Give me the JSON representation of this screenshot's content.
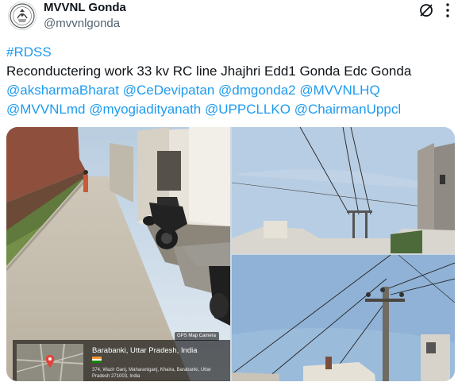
{
  "tweet": {
    "display_name": "MVVNL Gonda",
    "handle": "@mvvnlgonda",
    "hashtag": "#RDSS",
    "body": "Reconductering work  33 kv RC line Jhajhri Edd1 Gonda Edc Gonda",
    "mentions_line1": [
      "@aksharmaBharat",
      "@CeDevipatan",
      "@dmgonda2",
      "@MVVNLHQ"
    ],
    "mentions_line2": [
      "@MVVNLmd",
      "@myogiadityanath",
      "@UPPCLLKO",
      "@ChairmanUppcl"
    ]
  },
  "icons": {
    "grok": "grok-icon",
    "more": "more-icon",
    "avatar": "up-govt-emblem"
  },
  "gps": {
    "badge": "GPS Map Camera",
    "city": "Barabanki, Uttar Pradesh, India",
    "address": "374, Wazir Ganj, Maharaniganj, Khaira, Barabanki, Uttar Pradesh 271003, India"
  },
  "colors": {
    "link": "#1d9bf0",
    "text": "#0f1419",
    "secondary": "#536471"
  }
}
